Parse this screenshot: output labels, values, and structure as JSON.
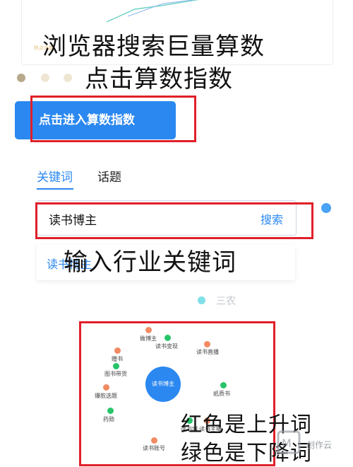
{
  "overlay": {
    "line1": "浏览器搜索巨量算数",
    "line2": "点击算数指数",
    "line3": "输入行业关键词",
    "line4": "红色是上升词",
    "line5": "绿色是下降词"
  },
  "top_chart": {
    "tag": "热点话题"
  },
  "enter_button": {
    "label": "点击进入算数指数"
  },
  "tabs": [
    {
      "label": "关键词",
      "active": true
    },
    {
      "label": "话题",
      "active": false
    }
  ],
  "search": {
    "value": "读书博主",
    "button_label": "搜索"
  },
  "suggestion": {
    "text": "读书博主"
  },
  "background_tag": "三农",
  "keyword_map": {
    "center": "读书博主",
    "nodes": [
      {
        "label": "做博主",
        "trend": "up"
      },
      {
        "label": "读书变现",
        "trend": "down"
      },
      {
        "label": "读书直播",
        "trend": "up"
      },
      {
        "label": "赠书",
        "trend": "up"
      },
      {
        "label": "图书带货",
        "trend": "down"
      },
      {
        "label": "纸质书",
        "trend": "down"
      },
      {
        "label": "爆款选题",
        "trend": "up"
      },
      {
        "label": "药勋",
        "trend": "down"
      },
      {
        "label": "读书账号",
        "trend": "up"
      },
      {
        "label": "读书博",
        "trend": "down"
      },
      {
        "label": "读书主播",
        "trend": "up"
      }
    ]
  },
  "colors": {
    "accent": "#2b88f0",
    "up": "#f28a62",
    "down": "#27c46a",
    "highlight_box": "#e0202a"
  },
  "watermark": "创作云"
}
